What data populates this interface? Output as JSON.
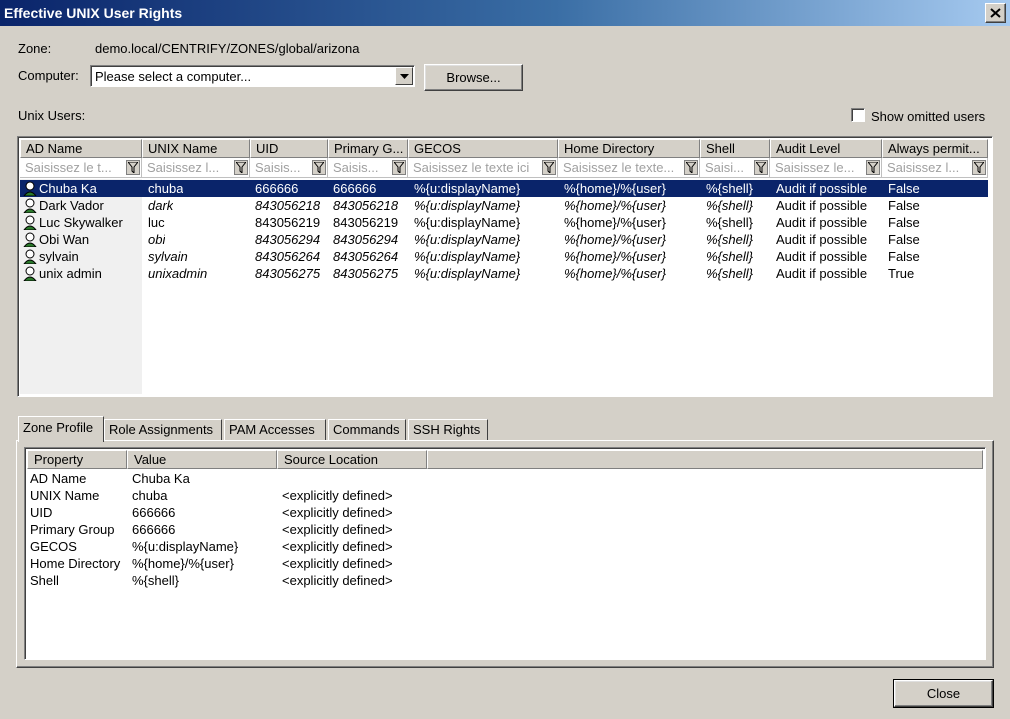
{
  "window": {
    "title": "Effective UNIX User Rights"
  },
  "zone": {
    "label": "Zone:",
    "value": "demo.local/CENTRIFY/ZONES/global/arizona"
  },
  "computer": {
    "label": "Computer:",
    "placeholder": "Please select a computer...",
    "browse_label": "Browse..."
  },
  "unix_users_label": "Unix Users:",
  "show_omitted": {
    "label": "Show omitted users",
    "checked": false
  },
  "users_table": {
    "columns": [
      "AD Name",
      "UNIX Name",
      "UID",
      "Primary G...",
      "GECOS",
      "Home Directory",
      "Shell",
      "Audit Level",
      "Always permit..."
    ],
    "filters": [
      "Saisissez le t...",
      "Saisissez l...",
      "Saisis...",
      "Saisis...",
      "Saisissez le texte ici",
      "Saisissez le texte...",
      "Saisi...",
      "Saisissez le...",
      "Saisissez l..."
    ],
    "rows": [
      {
        "cells": [
          "Chuba Ka",
          "chuba",
          "666666",
          "666666",
          "%{u:displayName}",
          "%{home}/%{user}",
          "%{shell}",
          "Audit if possible",
          "False"
        ],
        "selected": true,
        "italic": false
      },
      {
        "cells": [
          "Dark Vador",
          "dark",
          "843056218",
          "843056218",
          "%{u:displayName}",
          "%{home}/%{user}",
          "%{shell}",
          "Audit if possible",
          "False"
        ],
        "selected": false,
        "italic": true
      },
      {
        "cells": [
          "Luc Skywalker",
          "luc",
          "843056219",
          "843056219",
          "%{u:displayName}",
          "%{home}/%{user}",
          "%{shell}",
          "Audit if possible",
          "False"
        ],
        "selected": false,
        "italic": false
      },
      {
        "cells": [
          "Obi Wan",
          "obi",
          "843056294",
          "843056294",
          "%{u:displayName}",
          "%{home}/%{user}",
          "%{shell}",
          "Audit if possible",
          "False"
        ],
        "selected": false,
        "italic": true
      },
      {
        "cells": [
          "sylvain",
          "sylvain",
          "843056264",
          "843056264",
          "%{u:displayName}",
          "%{home}/%{user}",
          "%{shell}",
          "Audit if possible",
          "False"
        ],
        "selected": false,
        "italic": true
      },
      {
        "cells": [
          "unix admin",
          "unixadmin",
          "843056275",
          "843056275",
          "%{u:displayName}",
          "%{home}/%{user}",
          "%{shell}",
          "Audit if possible",
          "True"
        ],
        "selected": false,
        "italic": true
      }
    ]
  },
  "tabs": [
    {
      "label": "Zone Profile",
      "active": true
    },
    {
      "label": "Role Assignments",
      "active": false
    },
    {
      "label": "PAM Accesses",
      "active": false
    },
    {
      "label": "Commands",
      "active": false
    },
    {
      "label": "SSH Rights",
      "active": false
    }
  ],
  "profile_table": {
    "columns": [
      "Property",
      "Value",
      "Source Location"
    ],
    "rows": [
      [
        "AD Name",
        "Chuba Ka",
        ""
      ],
      [
        "UNIX Name",
        "chuba",
        "<explicitly defined>"
      ],
      [
        "UID",
        "666666",
        "<explicitly defined>"
      ],
      [
        "Primary Group",
        "666666",
        "<explicitly defined>"
      ],
      [
        "GECOS",
        "%{u:displayName}",
        "<explicitly defined>"
      ],
      [
        "Home Directory",
        "%{home}/%{user}",
        "<explicitly defined>"
      ],
      [
        "Shell",
        "%{shell}",
        "<explicitly defined>"
      ]
    ]
  },
  "footer": {
    "close_label": "Close"
  },
  "colors": {
    "selection": "#0a246a",
    "title_start": "#0a246a",
    "title_end": "#a6caf0"
  }
}
